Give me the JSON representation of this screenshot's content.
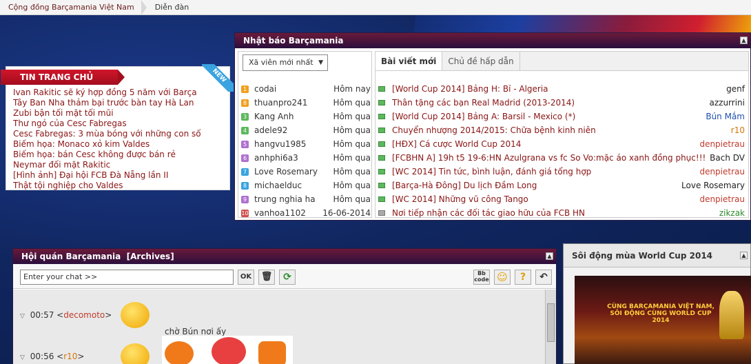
{
  "breadcrumb": {
    "home": "Cộng đồng Barçamania Việt Nam",
    "current": "Diễn đàn"
  },
  "news": {
    "title": "TIN TRANG CHỦ",
    "badge": "NEW",
    "items": [
      "Ivan Rakitic sẽ ký hợp đồng 5 năm với Barça",
      "Tây Ban Nha thảm bại trước bàn tay Hà Lan",
      "Zubi bận tối mặt tối mũi",
      "Thư ngỏ của Cesc Fabregas",
      "Cesc Fabregas: 3 mùa bóng với những con số",
      "Biếm họa: Monaco xỏ kim Valdes",
      "Biếm họa: bán Cesc không được bán rẻ",
      "Neymar đối mặt Rakitic",
      "[Hình ảnh] Đại hội FCB Đà Nẵng lần II",
      "Thật tội nghiệp cho Valdes"
    ]
  },
  "nhatbao": {
    "title": "Nhật báo Barçamania",
    "select": "Xã viên mới nhất",
    "users": [
      {
        "name": "codai",
        "time": "Hôm nay",
        "badge": "1",
        "color": "#f0a020"
      },
      {
        "name": "thuanpro241",
        "time": "Hôm qua",
        "badge": "8",
        "color": "#f0a020"
      },
      {
        "name": "Kang Anh",
        "time": "Hôm qua",
        "badge": "3",
        "color": "#5cb85c"
      },
      {
        "name": "adele92",
        "time": "Hôm qua",
        "badge": "4",
        "color": "#5cb85c"
      },
      {
        "name": "hangvu1985",
        "time": "Hôm qua",
        "badge": "5",
        "color": "#b070d0"
      },
      {
        "name": "anhphi6a3",
        "time": "Hôm qua",
        "badge": "6",
        "color": "#b070d0"
      },
      {
        "name": "Love Rosemary",
        "time": "Hôm qua",
        "badge": "7",
        "color": "#3aa3e0"
      },
      {
        "name": "michaelduc",
        "time": "Hôm qua",
        "badge": "8",
        "color": "#3aa3e0"
      },
      {
        "name": "trung nghia ha",
        "time": "Hôm qua",
        "badge": "9",
        "color": "#b070d0"
      },
      {
        "name": "vanhoa1102",
        "time": "16-06-2014",
        "badge": "10",
        "color": "#d05050"
      }
    ],
    "tabs": [
      "Bài viết mới",
      "Chủ đề hấp dẫn"
    ],
    "posts": [
      {
        "title": "[World Cup 2014] Bảng H: Bỉ - Algeria",
        "author": "genf",
        "acolor": "#222"
      },
      {
        "title": "Thân tặng các bạn Real Madrid (2013-2014)",
        "author": "azzurrini",
        "acolor": "#222"
      },
      {
        "title": "[World Cup 2014] Bảng A: Barsil - Mexico (*)",
        "author": "Bún Mắm",
        "acolor": "#1f4fb0"
      },
      {
        "title": "Chuyển nhượng 2014/2015: Chữa bệnh kinh niên",
        "author": "r10",
        "acolor": "#d4760a"
      },
      {
        "title": "[HĐX] Cá cược World Cup 2014",
        "author": "denpietrau",
        "acolor": "#c0392b"
      },
      {
        "title": "[FCBHN A] 19h t5 19-6:HN Azulgrana vs fc So Vo:mặc áo xanh đồng phục!!!",
        "author": "Bach DV",
        "acolor": "#222"
      },
      {
        "title": "[WC 2014] Tin tức, bình luận, đánh giá tổng hợp",
        "author": "denpietrau",
        "acolor": "#c0392b"
      },
      {
        "title": "[Barça-Hà Đông] Du lịch Đầm Long",
        "author": "Love Rosemary",
        "acolor": "#222"
      },
      {
        "title": "[WC 2014] Những vũ công Tango",
        "author": "denpietrau",
        "acolor": "#c0392b"
      },
      {
        "title": "Nơi tiếp nhận các đối tác giao hữu của FCB HN",
        "author": "zikzak",
        "acolor": "#2a8a2a"
      }
    ]
  },
  "hoiquan": {
    "title": "Hội quán Barçamania",
    "archives": "[Archives]",
    "input_placeholder": "Enter your chat >>",
    "ok": "OK",
    "messages": [
      {
        "time": "00:57",
        "name": "decomoto"
      },
      {
        "time": "00:56",
        "name": "r10"
      }
    ],
    "chat_text": "chờ Bún nơi ấy"
  },
  "worldcup": {
    "title": "Sôi động mùa World Cup 2014",
    "image_caption_1": "CÙNG BARÇAMANIA VIỆT NAM,",
    "image_caption_2": "SÔI ĐỘNG CÙNG WORLD CUP 2014"
  }
}
